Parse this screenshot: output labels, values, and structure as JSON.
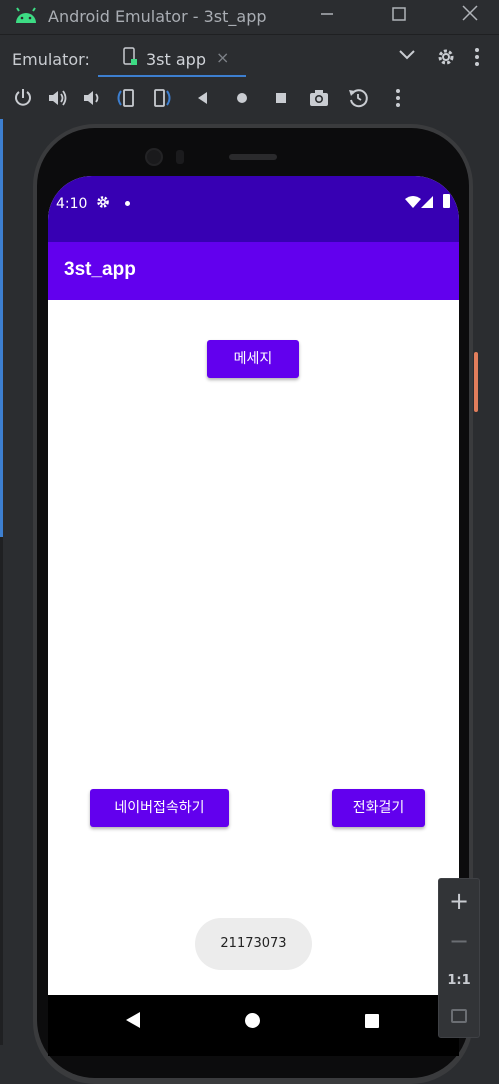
{
  "window": {
    "title": "Android Emulator - 3st_app"
  },
  "tabbar": {
    "label": "Emulator:",
    "tab_label": "3st app",
    "tab_close": "×"
  },
  "toolbar": {
    "icons": [
      "power-icon",
      "volume-up-icon",
      "volume-down-icon",
      "rotate-left-icon",
      "rotate-right-icon",
      "back-icon",
      "home-icon",
      "overview-icon",
      "camera-icon",
      "replay-icon",
      "more-icon"
    ]
  },
  "device": {
    "status": {
      "time": "4:10"
    },
    "app_title": "3st_app",
    "buttons": {
      "message": "메세지",
      "naver": "네이버접속하기",
      "call": "전화걸기"
    },
    "toast": "21173073"
  },
  "zoom": {
    "plus": "+",
    "minus": "−",
    "one_to_one": "1:1"
  },
  "colors": {
    "status_bar": "#3700b3",
    "app_bar": "#6200ee",
    "button": "#6200ee",
    "accent_tab": "#3d7fd0"
  }
}
